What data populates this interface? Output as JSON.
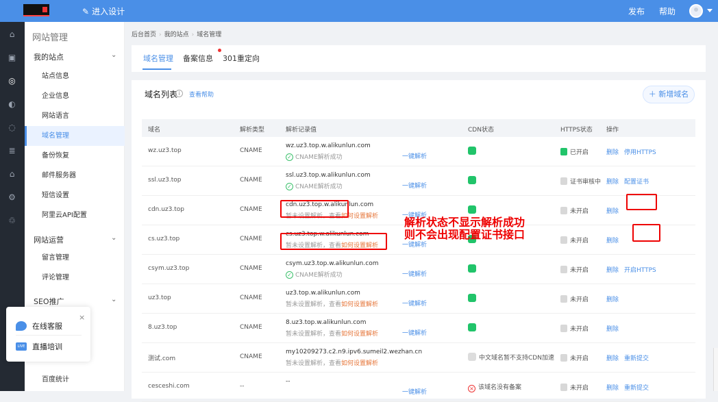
{
  "header": {
    "design": "进入设计",
    "publish": "发布",
    "help": "帮助"
  },
  "sidebar": {
    "title": "网站管理",
    "groups": [
      {
        "label": "我的站点"
      },
      {
        "label": "网站运营"
      },
      {
        "label": "SEO推广"
      }
    ],
    "items": [
      {
        "label": "站点信息"
      },
      {
        "label": "企业信息"
      },
      {
        "label": "网站语言"
      },
      {
        "label": "域名管理"
      },
      {
        "label": "备份恢复"
      },
      {
        "label": "邮件服务器"
      },
      {
        "label": "短信设置"
      },
      {
        "label": "阿里云API配置"
      },
      {
        "label": "留言管理"
      },
      {
        "label": "评论管理"
      },
      {
        "label": "百度统计"
      }
    ]
  },
  "breadcrumb": [
    "后台首页",
    "我的站点",
    "域名管理"
  ],
  "tabs": [
    {
      "label": "域名管理"
    },
    {
      "label": "备案信息"
    },
    {
      "label": "301重定向"
    }
  ],
  "panel": {
    "title": "域名列表",
    "help": "查看帮助",
    "add": "＋ 新增域名"
  },
  "table": {
    "headers": [
      "域名",
      "解析类型",
      "解析记录值",
      "CDN状态",
      "HTTPS状态",
      "操作"
    ],
    "rows": [
      {
        "domain": "wz.uz3.top",
        "type": "CNAME",
        "record": "wz.uz3.top.w.alikunlun.com",
        "status": "CNAME解析成功",
        "status_ok": true,
        "oneclick": "一键解析",
        "cdn": "green",
        "cdn_text": "",
        "https": "已开启",
        "https_on": true,
        "ops": [
          "删除",
          "停用HTTPS"
        ]
      },
      {
        "domain": "ssl.uz3.top",
        "type": "CNAME",
        "record": "ssl.uz3.top.w.alikunlun.com",
        "status": "CNAME解析成功",
        "status_ok": true,
        "oneclick": "一键解析",
        "cdn": "green",
        "cdn_text": "",
        "https": "证书审核中",
        "https_on": false,
        "ops": [
          "删除",
          "配置证书"
        ]
      },
      {
        "domain": "cdn.uz3.top",
        "type": "CNAME",
        "record": "cdn.uz3.top.w.alikunlun.com",
        "status": "暂未设置解析，查看",
        "status_link": "如何设置解析",
        "status_ok": false,
        "oneclick": "一键解析",
        "cdn": "green",
        "cdn_text": "",
        "https": "未开启",
        "https_on": false,
        "ops": [
          "删除"
        ]
      },
      {
        "domain": "cs.uz3.top",
        "type": "CNAME",
        "record": "cs.uz3.top.w.alikunlun.com",
        "status": "暂未设置解析，查看",
        "status_link": "如何设置解析",
        "status_ok": false,
        "oneclick": "一键解析",
        "cdn": "green",
        "cdn_text": "",
        "https": "未开启",
        "https_on": false,
        "ops": [
          "删除"
        ]
      },
      {
        "domain": "csym.uz3.top",
        "type": "CNAME",
        "record": "csym.uz3.top.w.alikunlun.com",
        "status": "CNAME解析成功",
        "status_ok": true,
        "oneclick": "一键解析",
        "cdn": "green",
        "cdn_text": "",
        "https": "未开启",
        "https_on": false,
        "ops": [
          "删除",
          "开启HTTPS"
        ]
      },
      {
        "domain": "uz3.top",
        "type": "CNAME",
        "record": "uz3.top.w.alikunlun.com",
        "status": "暂未设置解析，查看",
        "status_link": "如何设置解析",
        "status_ok": false,
        "oneclick": "一键解析",
        "cdn": "green",
        "cdn_text": "",
        "https": "未开启",
        "https_on": false,
        "ops": [
          "删除"
        ]
      },
      {
        "domain": "8.uz3.top",
        "type": "CNAME",
        "record": "8.uz3.top.w.alikunlun.com",
        "status": "暂未设置解析，查看",
        "status_link": "如何设置解析",
        "status_ok": false,
        "oneclick": "一键解析",
        "cdn": "green",
        "cdn_text": "",
        "https": "未开启",
        "https_on": false,
        "ops": [
          "删除"
        ]
      },
      {
        "domain": "测试.com",
        "type": "CNAME",
        "record": "my10209273.c2.n9.ipv6.sumeil2.wezhan.cn",
        "status": "暂未设置解析，查看",
        "status_link": "如何设置解析",
        "status_ok": false,
        "oneclick": "",
        "cdn": "grey",
        "cdn_text": "中文域名暂不支持CDN加速",
        "https": "未开启",
        "https_on": false,
        "ops": [
          "删除",
          "重新提交"
        ]
      },
      {
        "domain": "cesceshi.com",
        "type": "--",
        "record": "--",
        "status": "",
        "status_ok": false,
        "oneclick": "一键解析",
        "cdn": "x",
        "cdn_text": "该域名没有备案",
        "https": "未开启",
        "https_on": false,
        "ops": [
          "删除",
          "重新提交"
        ]
      }
    ]
  },
  "annotation": {
    "line1": "解析状态不显示解析成功",
    "line2": "则不会出现配置证书接口"
  },
  "chat": {
    "service": "在线客服",
    "live": "直播培训",
    "live_icon": "LIVE",
    "close": "×"
  },
  "colors": {
    "topbar": "#4a8fe7",
    "accent": "#4a8fe7",
    "green": "#21c46a",
    "red": "#e00000",
    "orange": "#e6763a"
  }
}
